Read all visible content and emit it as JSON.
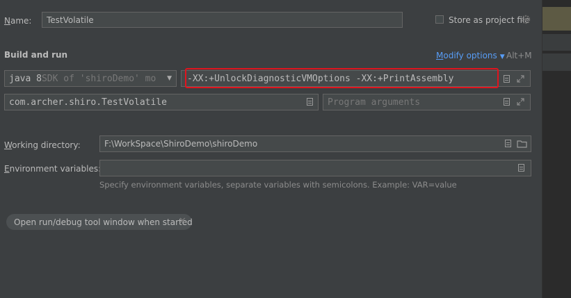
{
  "name_row": {
    "label_prefix": "N",
    "label_rest": "ame:",
    "value": "TestVolatile",
    "store_label": "Store as project file"
  },
  "build_run": {
    "heading": "Build and run",
    "modify_options_prefix": "M",
    "modify_options_rest": "odify options",
    "modify_shortcut": "Alt+M",
    "jdk_name": "java 8",
    "jdk_detail": " SDK of 'shiroDemo' mo",
    "vm_options": "-XX:+UnlockDiagnosticVMOptions -XX:+PrintAssembly",
    "main_class": "com.archer.shiro.TestVolatile",
    "program_args_placeholder": "Program arguments"
  },
  "working_dir": {
    "label_prefix": "W",
    "label_rest": "orking directory:",
    "value": "F:\\WorkSpace\\ShiroDemo\\shiroDemo"
  },
  "env_vars": {
    "label_prefix": "E",
    "label_rest": "nvironment variables:",
    "value": "",
    "hint": "Specify environment variables, separate variables with semicolons. Example: VAR=value"
  },
  "option_chip": {
    "label": "Open run/debug tool window when started"
  },
  "colors": {
    "highlight_box": "#e0141e",
    "link": "#589df6",
    "background": "#3c3f41"
  }
}
